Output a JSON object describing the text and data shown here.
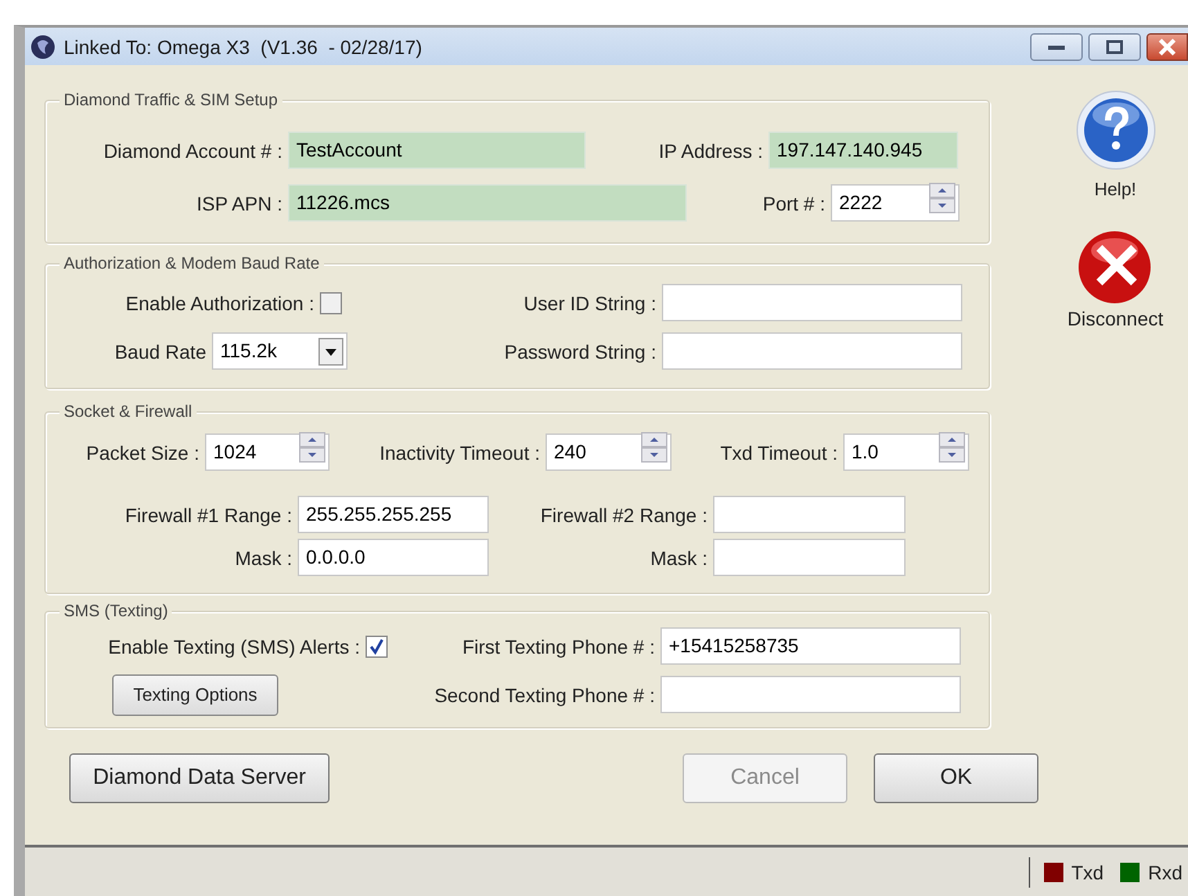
{
  "window": {
    "title": "Linked To: Omega X3  (V1.36  - 02/28/17)"
  },
  "sections": [
    {
      "title": "Diamond Traffic & SIM Setup",
      "rows": [
        [
          {
            "kind": "text",
            "label": "Diamond Account # :",
            "value": "TestAccount",
            "readonly": true
          },
          {
            "kind": "text",
            "label": "IP Address :",
            "value": "197.147.140.945",
            "readonly": true
          }
        ],
        [
          {
            "kind": "text",
            "label": "ISP APN :",
            "value": "11226.mcs",
            "readonly": true
          },
          {
            "kind": "spin",
            "label": "Port # :",
            "value": "2222"
          }
        ]
      ]
    },
    {
      "title": "Authorization & Modem Baud Rate",
      "rows": [
        [
          {
            "kind": "checkbox",
            "label": "Enable Authorization :",
            "checked": false
          },
          {
            "kind": "text",
            "label": "User ID String :",
            "readonly": false
          }
        ],
        [
          {
            "kind": "combo",
            "label": "Baud Rate",
            "value": "115.2k"
          },
          {
            "kind": "text",
            "label": "Password String :",
            "readonly": false
          }
        ]
      ]
    },
    {
      "title": "Socket & Firewall",
      "rows": [
        [
          {
            "kind": "spin",
            "label": "Packet Size :",
            "value": "1024"
          },
          {
            "kind": "spin",
            "label": "Inactivity Timeout :",
            "value": "240"
          },
          {
            "kind": "spin",
            "label": "Txd Timeout :",
            "value": "1.0"
          }
        ],
        [
          {
            "kind": "text",
            "label": "Firewall #1 Range :",
            "value": "255.255.255.255",
            "readonly": false
          },
          {
            "kind": "text",
            "label": "Firewall #2 Range :",
            "readonly": false
          }
        ],
        [
          {
            "kind": "text",
            "label": "Mask :",
            "value": "0.0.0.0",
            "readonly": false
          },
          {
            "kind": "text",
            "label": "Mask :",
            "readonly": false
          }
        ]
      ]
    },
    {
      "title": "SMS (Texting)",
      "rows": [
        [
          {
            "kind": "checkbox",
            "label": "Enable Texting (SMS) Alerts :",
            "checked": true
          },
          {
            "kind": "text",
            "label": "First Texting Phone # :",
            "value": "+15415258735",
            "readonly": false
          }
        ],
        [
          {
            "kind": "button",
            "label": "Texting Options"
          },
          {
            "kind": "text",
            "label": "Second Texting Phone # :",
            "readonly": false
          }
        ]
      ]
    }
  ],
  "side_buttons": [
    {
      "kind": "help",
      "label": "Help!"
    },
    {
      "kind": "disconnect",
      "label": "Disconnect"
    }
  ],
  "buttons": [
    {
      "label": "Diamond Data Server",
      "disabled": false
    },
    {
      "label": "Cancel",
      "disabled": true
    },
    {
      "label": "OK",
      "disabled": false
    }
  ],
  "status_bar": {
    "indicators": [
      {
        "label": "Txd",
        "color": "#800000"
      },
      {
        "label": "Rxd",
        "color": "#006400"
      }
    ]
  }
}
